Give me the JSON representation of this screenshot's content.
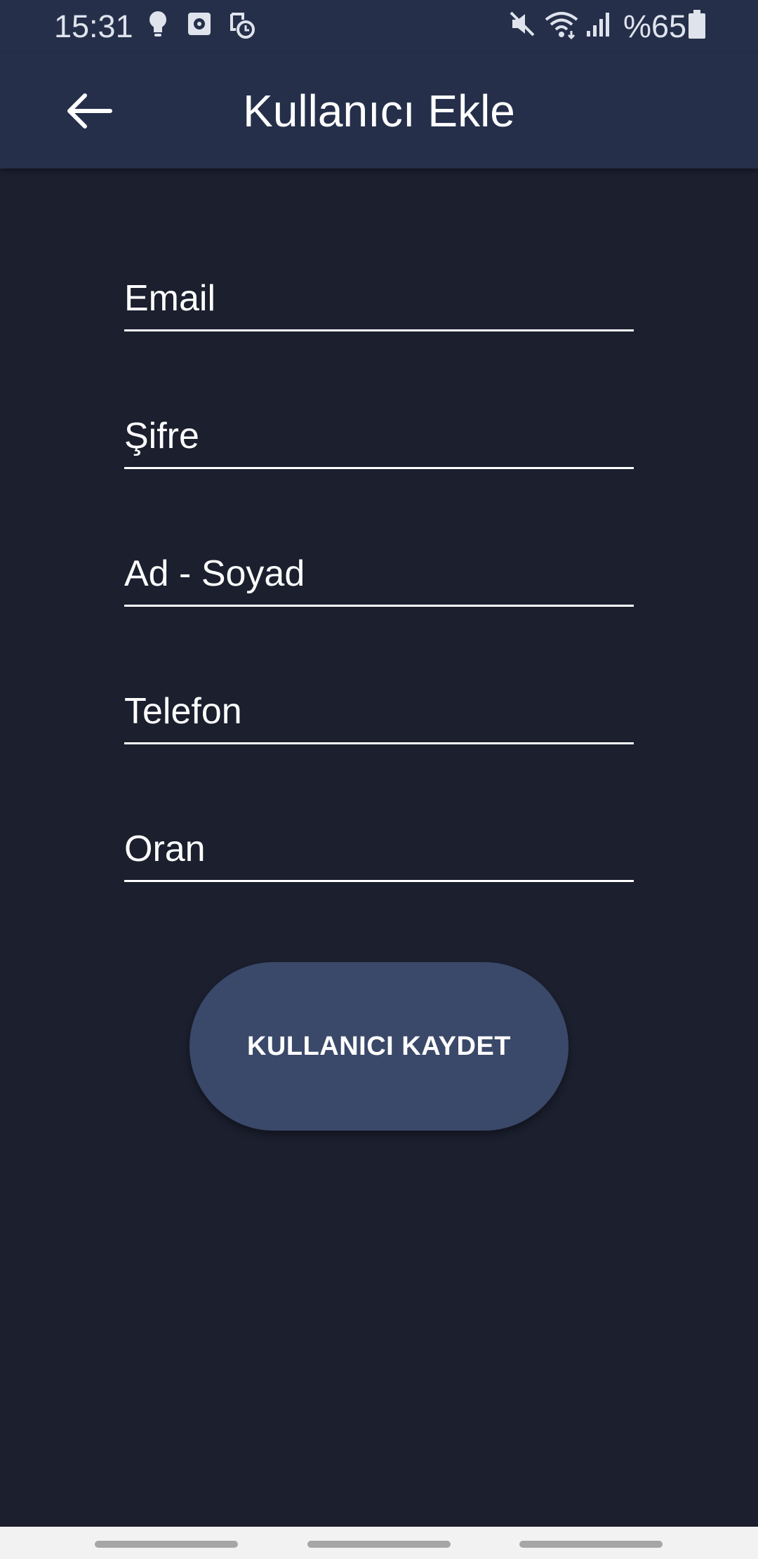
{
  "status_bar": {
    "time": "15:31",
    "battery": "%65",
    "icons": [
      "lightbulb-icon",
      "app-notification-icon",
      "clock-sync-icon",
      "mute-icon",
      "wifi-icon",
      "signal-icon",
      "battery-icon"
    ]
  },
  "app_bar": {
    "title": "Kullanıcı Ekle",
    "back_icon": "arrow-left-icon"
  },
  "form": {
    "fields": [
      {
        "placeholder": "Email",
        "value": ""
      },
      {
        "placeholder": "Şifre",
        "value": ""
      },
      {
        "placeholder": "Ad - Soyad",
        "value": ""
      },
      {
        "placeholder": "Telefon",
        "value": ""
      },
      {
        "placeholder": "Oran",
        "value": ""
      }
    ],
    "submit_label": "KULLANICI KAYDET"
  },
  "colors": {
    "background": "#1b1f2e",
    "app_bar": "#252f4a",
    "button": "#3a4869",
    "text": "#ffffff"
  }
}
